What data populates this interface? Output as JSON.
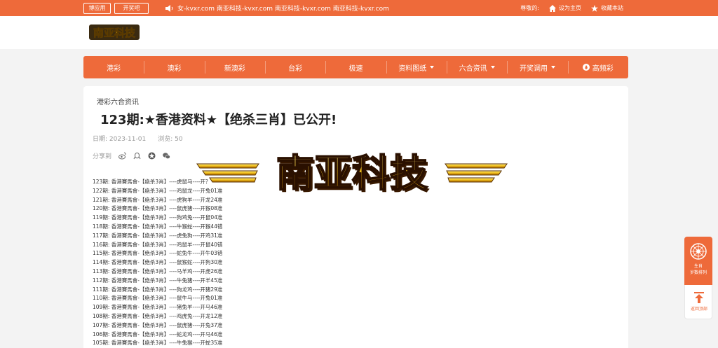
{
  "colors": {
    "accent": "#ee6a3a",
    "page_bg": "#f3f3f3",
    "card_bg": "#ffffff",
    "banner_gold": "#f0b000"
  },
  "topbar": {
    "btn_boyingyong": "博应用",
    "btn_kaijiangba": "开奖吧",
    "notice": "女-kvxr.com 南亚科技-kvxr.com 南亚科技-kvxr.com 南亚科技-kvxr.com",
    "greeting": "尊敬的:",
    "set_home": "设为主页",
    "bookmark": "收藏本站"
  },
  "logo": {
    "text": "南亚科技"
  },
  "nav": {
    "items": [
      {
        "label": "港彩",
        "dropdown": false
      },
      {
        "label": "澳彩",
        "dropdown": false
      },
      {
        "label": "新澳彩",
        "dropdown": false
      },
      {
        "label": "台彩",
        "dropdown": false
      },
      {
        "label": "极速",
        "dropdown": false
      },
      {
        "label": "资料图纸",
        "dropdown": true
      },
      {
        "label": "六合资讯",
        "dropdown": true
      },
      {
        "label": "开奖调用",
        "dropdown": true
      },
      {
        "label": "高频彩",
        "dropdown": false
      }
    ]
  },
  "article": {
    "breadcrumb": "港彩六合资讯",
    "title": "123期:★香港资料★【绝杀三肖】已公开!",
    "date": "日期: 2023-11-01",
    "views": "浏览: 50",
    "share_label": "分享到",
    "share_icons": [
      "weibo-icon",
      "qq-icon",
      "qzone-icon",
      "wechat-icon"
    ],
    "rows": [
      "123期: 香港賽馬會-【绝杀3肖】----虎鼠马----开？",
      "122期: 香港賽馬會-【绝杀3肖】----鸡鼠龙----开兔01准",
      "121期: 香港賽馬會-【绝杀3肖】----虎狗羊----开龙24准",
      "120期: 香港賽馬會-【绝杀3肖】----鼠虎猪----开猴08准",
      "119期: 香港賽馬會-【绝杀3肖】----狗鸡兔----开鼠04准",
      "118期: 香港賽馬會-【绝杀3肖】----牛猴蛇----开猴44错",
      "117期: 香港賽馬會-【绝杀3肖】----虎兔狗----开鸡31准",
      "116期: 香港賽馬會-【绝杀3肖】----鸡鼠羊----开鼠40错",
      "115期: 香港賽馬會-【绝杀3肖】----蛇兔牛----开牛03错",
      "114期: 香港賽馬會-【绝杀3肖】----鼠猴蛇----开狗30准",
      "113期: 香港賽馬會-【绝杀3肖】----马羊鸡----开虎26准",
      "112期: 香港賽馬會-【绝杀3肖】----牛兔猪----开羊45准",
      "111期: 香港賽馬會-【绝杀3肖】----狗龙鸡----开猪29准",
      "110期: 香港賽馬會-【绝杀3肖】----鼠牛马----开兔01准",
      "109期: 香港賽馬會-【绝杀3肖】----猪兔羊----开马46准",
      "108期: 香港賽馬會-【绝杀3肖】----鸡虎兔----开龙12准",
      "107期: 香港賽馬會-【绝杀3肖】----鼠虎猪----开兔37准",
      "106期: 香港賽馬會-【绝杀3肖】----蛇龙鸡----开马46准",
      "105期: 香港賽馬會-【绝杀3肖】----牛兔猴----开蛇35准"
    ]
  },
  "banner": {
    "text": "南亚科技"
  },
  "float_panel": {
    "btn1_line1": "生肖",
    "btn1_line2": "岁数排列",
    "btn2": "返回顶部"
  }
}
